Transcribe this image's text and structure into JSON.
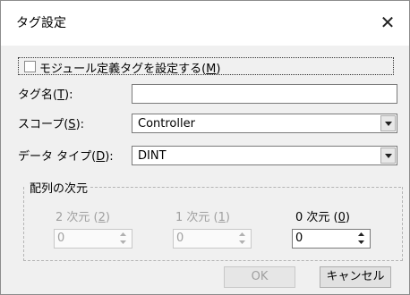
{
  "dialog": {
    "title": "タグ設定",
    "close_glyph": "✕"
  },
  "module_checkbox": {
    "label": "モジュール定義タグを設定する(",
    "hotkey": "M",
    "suffix": ")",
    "checked": false
  },
  "tag_name": {
    "label": "タグ名(",
    "hotkey": "T",
    "suffix": "):",
    "value": ""
  },
  "scope": {
    "label": "スコープ(",
    "hotkey": "S",
    "suffix": "):",
    "value": "Controller"
  },
  "data_type": {
    "label": "データ タイプ(",
    "hotkey": "D",
    "suffix": "):",
    "value": "DINT"
  },
  "dimensions": {
    "group_title": "配列の次元",
    "dim2": {
      "label": "2 次元 (",
      "hotkey": "2",
      "suffix": ")",
      "value": "0",
      "enabled": false
    },
    "dim1": {
      "label": "1 次元 (",
      "hotkey": "1",
      "suffix": ")",
      "value": "0",
      "enabled": false
    },
    "dim0": {
      "label": "0 次元 (",
      "hotkey": "0",
      "suffix": ")",
      "value": "0",
      "enabled": true
    }
  },
  "buttons": {
    "ok": "OK",
    "cancel": "キャンセル"
  },
  "colors": {
    "titlebar": "#ffffff",
    "body": "#f0f0f0",
    "disabled_text": "#a0a0a0"
  }
}
